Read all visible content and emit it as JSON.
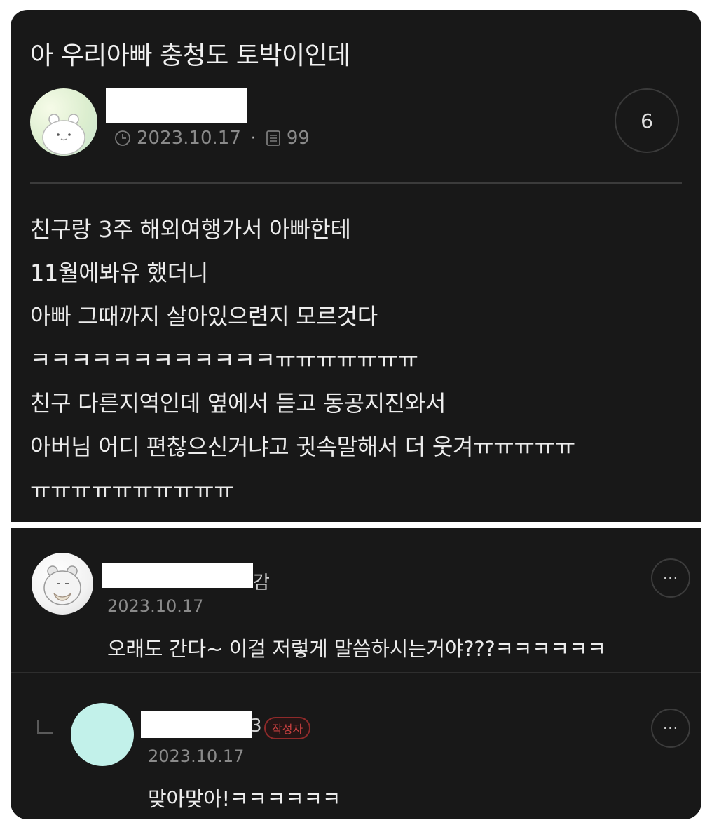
{
  "post": {
    "title": "아 우리아빠 충청도 토박이인데",
    "date": "2023.10.17",
    "meta_separator": "·",
    "views": "99",
    "comment_count": "6",
    "body_lines": [
      "친구랑 3주 해외여행가서 아빠한테",
      "11월에봐유 했더니",
      "아빠 그때까지 살아있으련지 모르것다",
      "ㅋㅋㅋㅋㅋㅋㅋㅋㅋㅋㅋㅋㅠㅠㅠㅠㅠㅠㅠ",
      "친구 다른지역인데 옆에서 듣고 동공지진와서",
      "아버님 어디 편찮으신거냐고 귓속말해서 더 웃겨ㅠㅠㅠㅠㅠ",
      "ㅠㅠㅠㅠㅠㅠㅠㅠㅠㅠ"
    ],
    "icons": {
      "clock": "clock-icon",
      "views": "document-icon"
    }
  },
  "comments": [
    {
      "name_visible_tail": "감",
      "date": "2023.10.17",
      "text": "오래도 간다~ 이걸 저렇게 말씀하시는거야???ㅋㅋㅋㅋㅋㅋ",
      "more_label": "···"
    },
    {
      "name_visible_tail": "3",
      "badge": "작성자",
      "date": "2023.10.17",
      "text": "맞아맞아!ㅋㅋㅋㅋㅋㅋ",
      "more_label": "···"
    }
  ],
  "colors": {
    "background": "#181818",
    "author_badge": "#c84040",
    "muted_text": "#8a8a8a"
  }
}
